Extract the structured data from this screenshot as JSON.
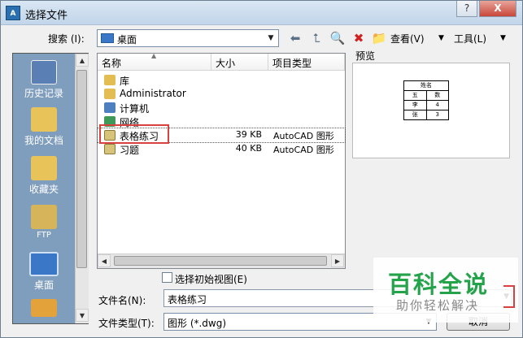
{
  "window": {
    "title": "选择文件",
    "app_icon_text": "A",
    "help_glyph": "?",
    "close_glyph": "X"
  },
  "toolbar": {
    "search_label": "搜索 (I):",
    "location": "桌面",
    "view_label": "查看(V)",
    "tools_label": "工具(L)"
  },
  "places": [
    {
      "label": "历史记录",
      "color": "#5a7fb5"
    },
    {
      "label": "我的文档",
      "color": "#e7c35a"
    },
    {
      "label": "收藏夹",
      "color": "#e7c35a"
    },
    {
      "label": "FTP",
      "color": "#d6b45a"
    },
    {
      "label": "桌面",
      "color": "#3a78c7"
    }
  ],
  "file_list": {
    "columns": [
      "名称",
      "大小",
      "项目类型"
    ],
    "rows": [
      {
        "name": "库",
        "size": "",
        "type": "",
        "icon_color": "#e3bd52"
      },
      {
        "name": "Administrator",
        "size": "",
        "type": "",
        "icon_color": "#e3bd52"
      },
      {
        "name": "计算机",
        "size": "",
        "type": "",
        "icon_color": "#4e7fc0"
      },
      {
        "name": "网络",
        "size": "",
        "type": "",
        "icon_color": "#3f9a5a"
      },
      {
        "name": "表格练习",
        "size": "39 KB",
        "type": "AutoCAD 图形",
        "icon_color": "#d8c37a"
      },
      {
        "name": "习题",
        "size": "40 KB",
        "type": "AutoCAD 图形",
        "icon_color": "#d8c37a"
      }
    ]
  },
  "preview": {
    "label": "预览",
    "table_header": "姓名",
    "table_cells": [
      [
        "五",
        "数"
      ],
      [
        "李",
        "4"
      ],
      [
        "张",
        "3"
      ]
    ]
  },
  "initial_view_label": "选择初始视图(E)",
  "filename": {
    "label": "文件名(N):",
    "value": "表格练习"
  },
  "filetype": {
    "label": "文件类型(T):",
    "value": "图形 (*.dwg)"
  },
  "buttons": {
    "cancel": "取消"
  },
  "watermark": {
    "main": "百科全说",
    "sub": "助你轻松解决"
  },
  "colors": {
    "highlight": "#d94040",
    "watermark_green": "#24a34a"
  }
}
